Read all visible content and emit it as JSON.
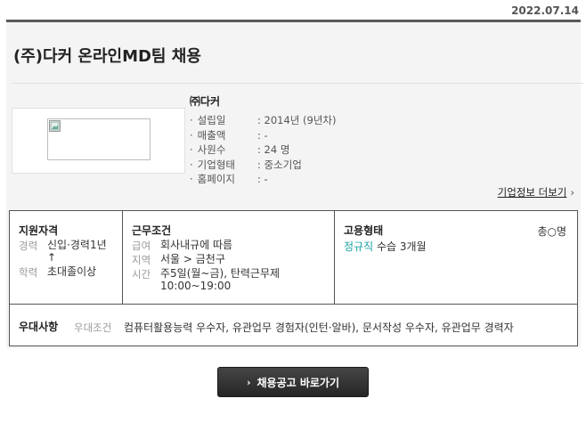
{
  "date": "2022.07.14",
  "title": "(주)다커 온라인MD팀 채용",
  "company": {
    "name": "㈜다커",
    "info": [
      {
        "label": "설립일",
        "value": ": 2014년 (9년차)"
      },
      {
        "label": "매출액",
        "value": ": -"
      },
      {
        "label": "사원수",
        "value": ": 24 명"
      },
      {
        "label": "기업형태",
        "value": ": 중소기업"
      },
      {
        "label": "홈페이지",
        "value": ": -"
      }
    ],
    "more_link": "기업정보 더보기"
  },
  "qualification": {
    "heading": "지원자격",
    "career_label": "경력",
    "career_value": "신입·경력1년 ↑",
    "edu_label": "학력",
    "edu_value": "초대졸이상"
  },
  "conditions": {
    "heading": "근무조건",
    "salary_label": "급여",
    "salary_value": "회사내규에 따름",
    "region_label": "지역",
    "region_value": "서울 > 금천구",
    "time_label": "시간",
    "time_value": "주5일(월~금), 탄력근무제10:00~19:00"
  },
  "employment": {
    "heading": "고용형태",
    "type": "정규직",
    "probation": "수습 3개월",
    "total": "총○명"
  },
  "preference": {
    "heading": "우대사항",
    "label": "우대조건",
    "value": "컴퓨터활용능력 우수자, 유관업무 경험자(인턴·알바), 문서작성 우수자, 유관업무 경력자"
  },
  "apply_button": "채용공고 바로가기",
  "colors": {
    "accent": "#1aa0a0",
    "button": "#333333"
  }
}
